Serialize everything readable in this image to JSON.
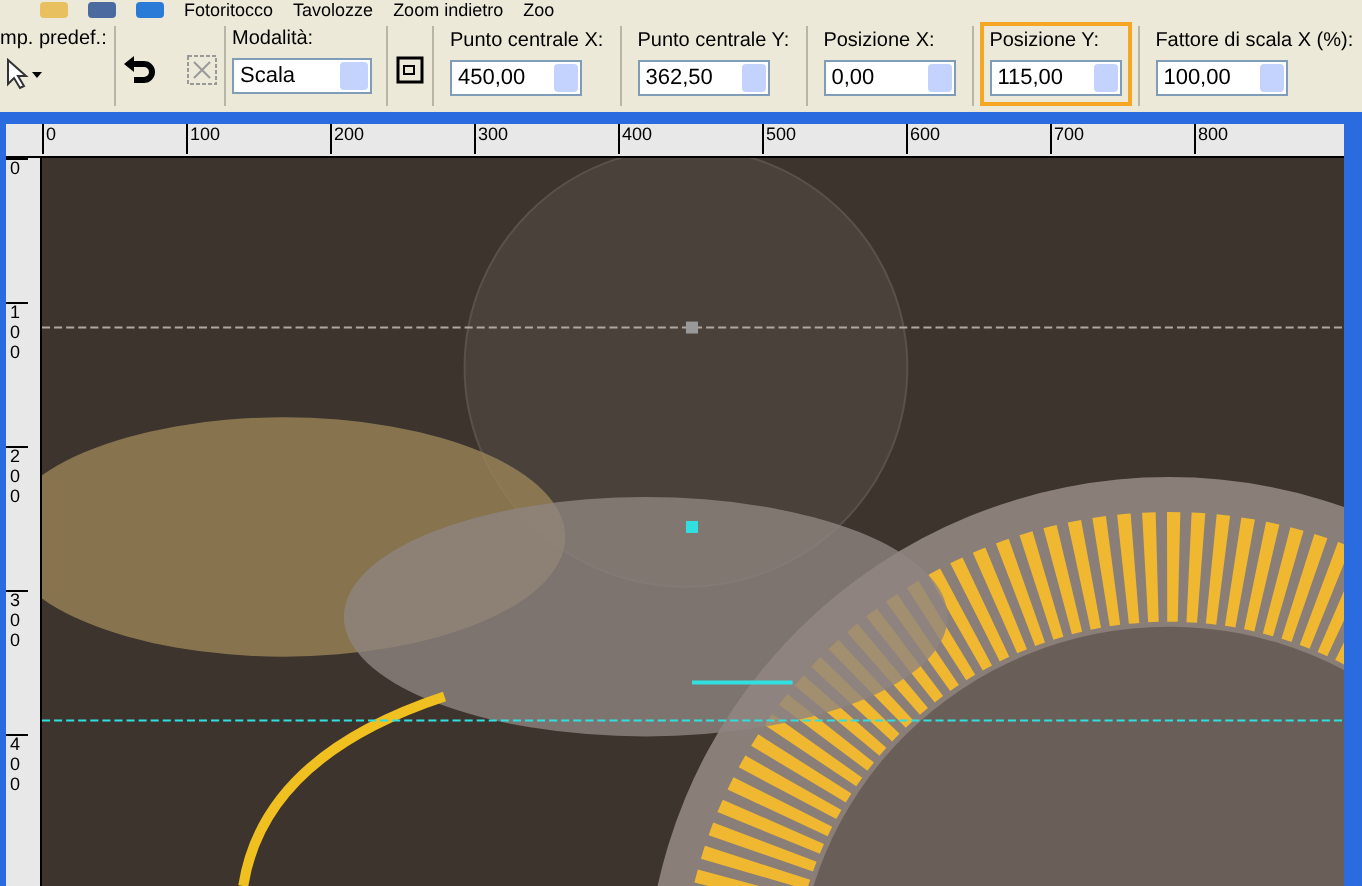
{
  "menu": [
    {
      "label": "Fotoritocco"
    },
    {
      "label": "Tavolozze"
    },
    {
      "label": "Zoom indietro"
    },
    {
      "label": "Zoo"
    }
  ],
  "options": {
    "preset_label": "mp. predef.:",
    "mode": {
      "label": "Modalità:",
      "value": "Scala"
    },
    "fields": [
      {
        "label": "Punto centrale X:",
        "value": "450,00",
        "highlighted": false
      },
      {
        "label": "Punto centrale Y:",
        "value": "362,50",
        "highlighted": false
      },
      {
        "label": "Posizione X:",
        "value": "0,00",
        "highlighted": false
      },
      {
        "label": "Posizione Y:",
        "value": "115,00",
        "highlighted": true
      },
      {
        "label": "Fattore di scala X (%):",
        "value": "100,00",
        "highlighted": false
      }
    ]
  },
  "ruler": {
    "horizontal": [
      "0",
      "100",
      "200",
      "300",
      "400",
      "500",
      "600",
      "700",
      "800"
    ],
    "vertical": [
      "0",
      "1 0 0",
      "2 0 0",
      "3 0 0",
      "4 0 0"
    ]
  }
}
